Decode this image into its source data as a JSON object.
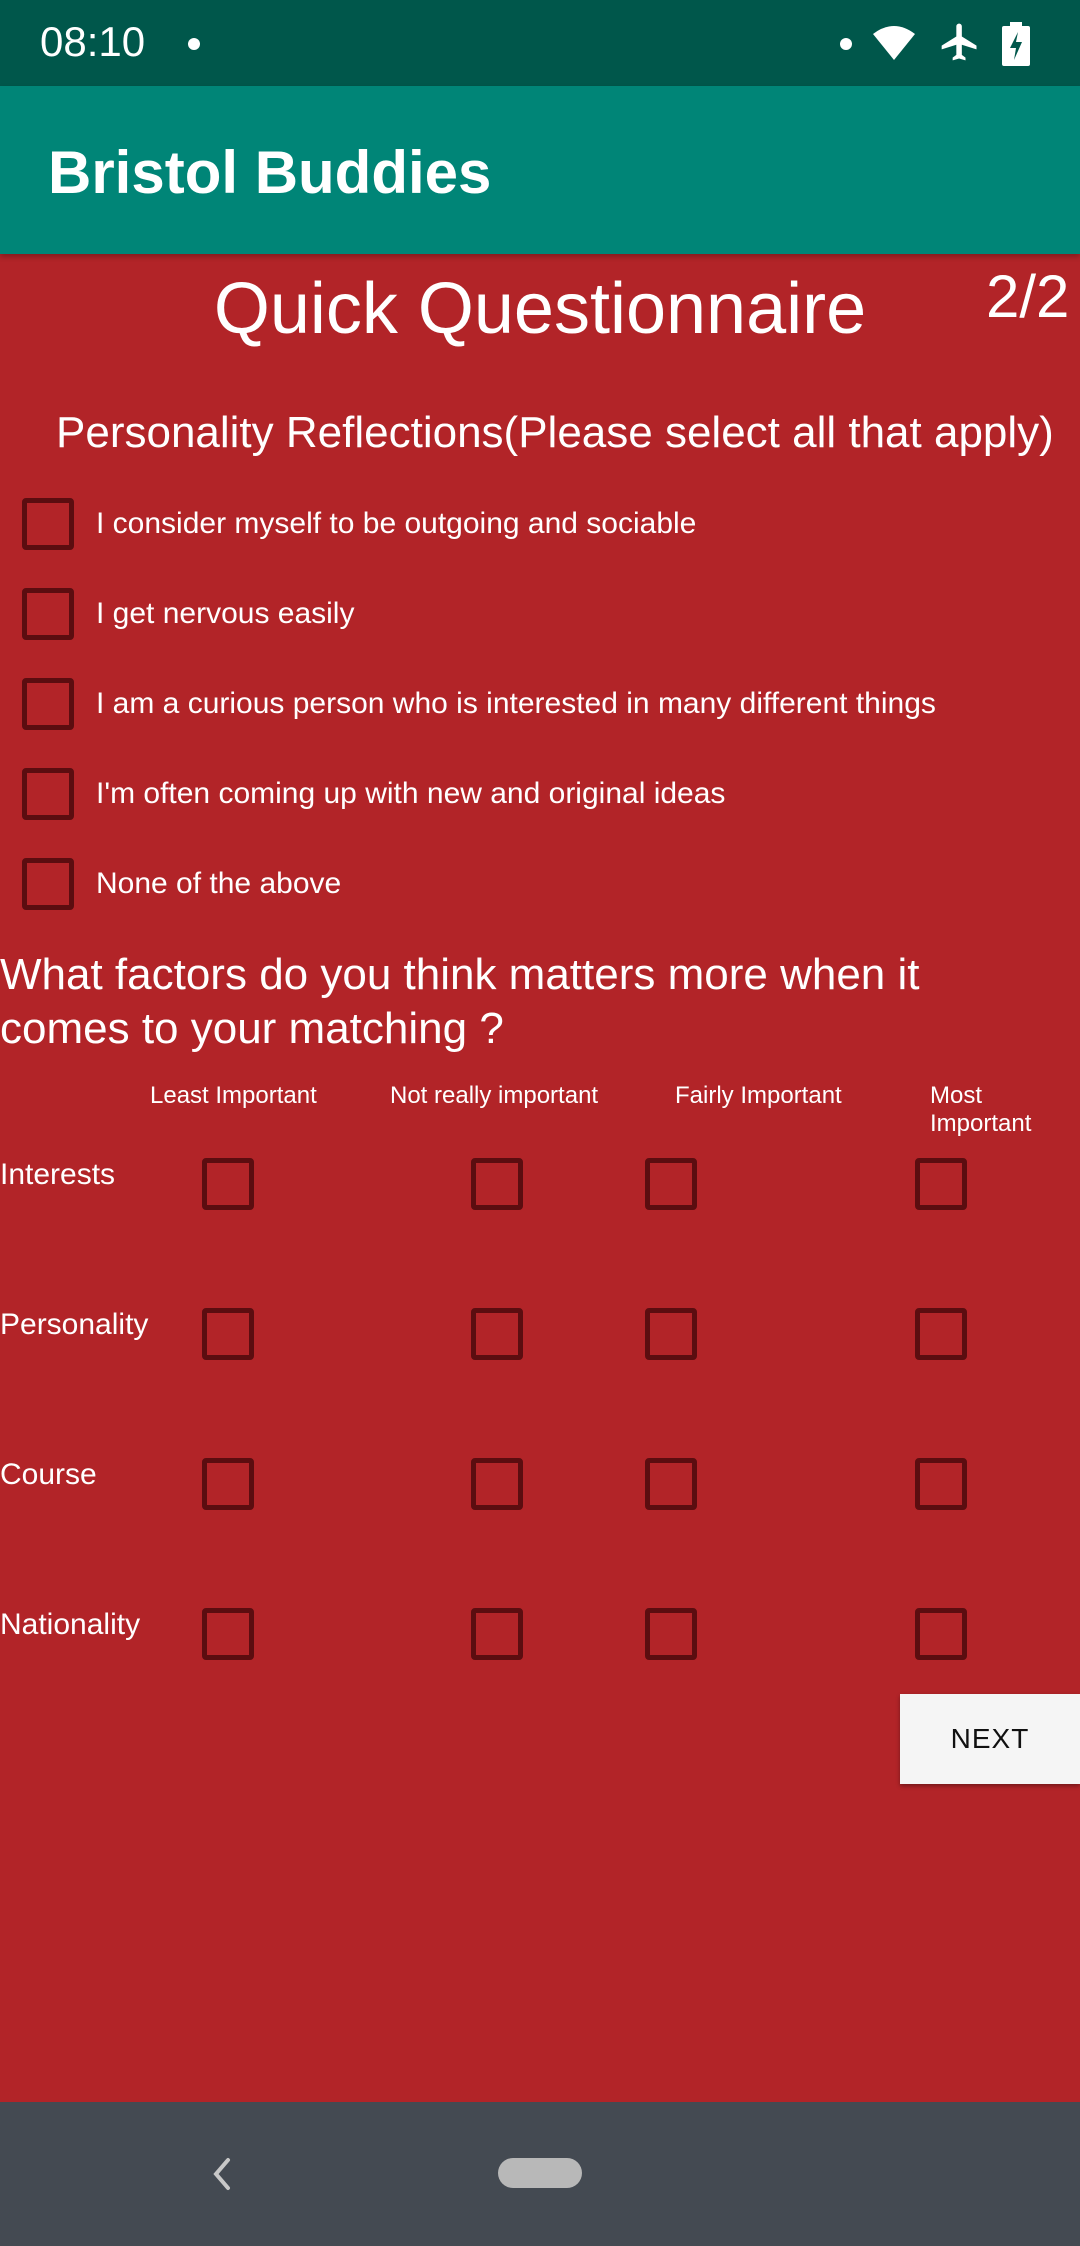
{
  "status_bar": {
    "time": "08:10",
    "icons": [
      "notification-dot-icon",
      "wifi-icon",
      "airplane-icon",
      "battery-icon"
    ]
  },
  "app_bar": {
    "title": "Bristol Buddies"
  },
  "page": {
    "title": "Quick Questionnaire",
    "indicator": "2/2"
  },
  "personality": {
    "heading": "Personality Reflections(Please select all that apply)",
    "options": [
      {
        "label": "I consider myself to be outgoing and sociable",
        "checked": false
      },
      {
        "label": "I get nervous easily",
        "checked": false
      },
      {
        "label": "I am a curious person who is interested in many different things",
        "checked": false
      },
      {
        "label": "I'm often coming up with new and original ideas",
        "checked": false
      },
      {
        "label": "None of the above",
        "checked": false
      }
    ]
  },
  "factors": {
    "heading": "What factors do you think matters more when it comes to your matching ?",
    "columns": [
      "Least Important",
      "Not really important",
      "Fairly Important",
      "Most Important"
    ],
    "rows": [
      "Interests",
      "Personality",
      "Course",
      "Nationality"
    ]
  },
  "next_label": "NEXT",
  "colors": {
    "status_bar": "#00574b",
    "app_bar": "#008577",
    "background": "#b22428",
    "checkbox_border": "#5b0d10",
    "nav_bar": "#444a52"
  }
}
